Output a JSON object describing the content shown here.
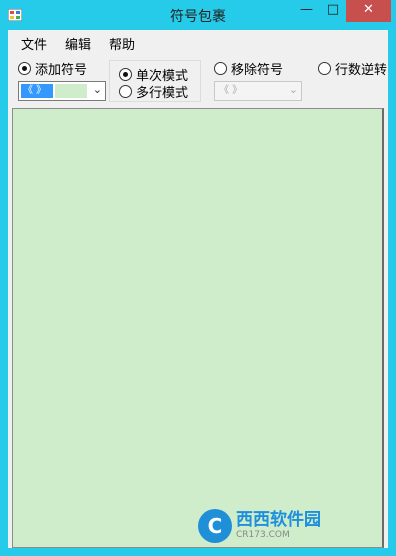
{
  "window": {
    "title": "符号包裹"
  },
  "titlebar_buttons": {
    "minimize": "—",
    "maximize": "□",
    "close": "✕"
  },
  "menu": [
    "文件",
    "编辑",
    "帮助"
  ],
  "options": {
    "add_symbol": {
      "label": "添加符号",
      "checked": true
    },
    "add_combo_value": "《 》",
    "single_mode": {
      "label": "单次模式",
      "checked": true
    },
    "multi_mode": {
      "label": "多行模式",
      "checked": false
    },
    "remove_symbol": {
      "label": "移除符号",
      "checked": false
    },
    "remove_combo_value": "《 》",
    "reverse_lines": {
      "label": "行数逆转",
      "checked": false
    }
  },
  "text_area": {
    "value": ""
  },
  "watermark": {
    "name": "西西软件园",
    "sub": "CR173.COM"
  },
  "colors": {
    "frame": "#25cbe8",
    "text_area_bg": "#cfedcb",
    "close_button": "#c7504f"
  }
}
